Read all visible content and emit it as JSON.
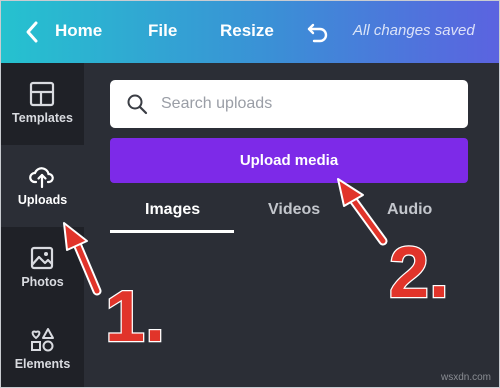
{
  "topbar": {
    "home_label": "Home",
    "file_label": "File",
    "resize_label": "Resize",
    "status_text": "All changes saved",
    "back_icon": "chevron-left-icon",
    "undo_icon": "undo-icon"
  },
  "sidebar": {
    "items": [
      {
        "label": "Templates",
        "icon": "templates-icon"
      },
      {
        "label": "Uploads",
        "icon": "cloud-upload-icon",
        "active": true
      },
      {
        "label": "Photos",
        "icon": "photo-icon"
      },
      {
        "label": "Elements",
        "icon": "shapes-icon"
      }
    ]
  },
  "main": {
    "search": {
      "placeholder": "Search uploads"
    },
    "upload_button": "Upload media",
    "tabs": [
      {
        "label": "Images",
        "active": true
      },
      {
        "label": "Videos"
      },
      {
        "label": "Audio"
      }
    ]
  },
  "annotations": {
    "step1": "1.",
    "step2": "2.",
    "color": "#e1342a"
  },
  "watermark": "wsxdn.com",
  "colors": {
    "brand_purple": "#7d2ae8",
    "sidebar_bg": "#1f2127",
    "panel_bg": "#2b2e36"
  }
}
